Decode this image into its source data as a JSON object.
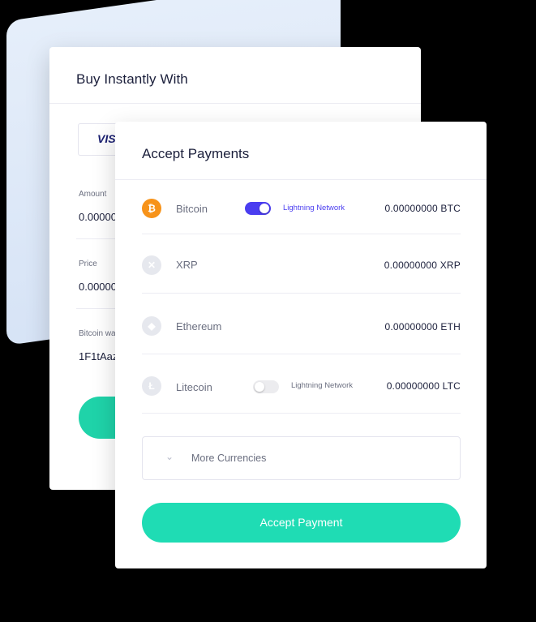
{
  "buy_card": {
    "title": "Buy Instantly With",
    "card_logo": "VISA",
    "fields": [
      {
        "label": "Amount",
        "value": "0.00000"
      },
      {
        "label": "Price",
        "value": "0.00000"
      },
      {
        "label": "Bitcoin wa",
        "value": "1F1tAaz"
      }
    ]
  },
  "accept_card": {
    "title": "Accept Payments",
    "currencies": [
      {
        "name": "Bitcoin",
        "icon": "bitcoin-icon",
        "glyph": "₿",
        "icon_color": "#f7931a",
        "amount": "0.00000000 BTC",
        "network_label": "Lightning Network",
        "toggle_on": true
      },
      {
        "name": "XRP",
        "icon": "xrp-icon",
        "glyph": "✕",
        "icon_color": "#e6e8ee",
        "amount": "0.00000000 XRP"
      },
      {
        "name": "Ethereum",
        "icon": "ethereum-icon",
        "glyph": "◆",
        "icon_color": "#e6e8ee",
        "amount": "0.00000000 ETH"
      },
      {
        "name": "Litecoin",
        "icon": "litecoin-icon",
        "glyph": "Ł",
        "icon_color": "#e6e8ee",
        "amount": "0.00000000 LTC",
        "network_label": "Lightning Network",
        "toggle_on": false
      }
    ],
    "more_currencies": "More Currencies",
    "button_label": "Accept Payment"
  },
  "colors": {
    "accent_green": "#1fdcb4",
    "toggle_purple": "#4a3df0",
    "bitcoin_orange": "#f7931a"
  }
}
